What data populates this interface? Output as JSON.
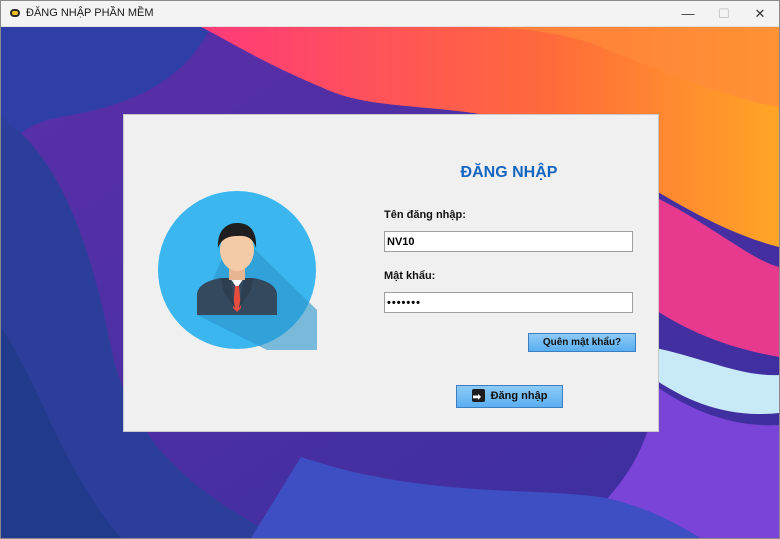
{
  "window": {
    "title": "ĐĂNG NHẬP PHẦN MỀM",
    "controls": {
      "minimize": "—",
      "maximize": "☐",
      "close": "✕"
    }
  },
  "form": {
    "heading": "ĐĂNG NHẬP",
    "username_label": "Tên đăng nhập:",
    "username_value": "NV10",
    "password_label": "Mật khẩu:",
    "password_value": "•••••••",
    "forgot_label": "Quên mật khẩu?",
    "login_label": "Đăng nhập"
  },
  "colors": {
    "heading": "#1566c0",
    "button": "#5aaef0",
    "avatar_circle": "#3bb6ee"
  },
  "icons": {
    "app": "app-icon",
    "avatar": "user-avatar-icon",
    "login": "login-arrow-icon"
  }
}
